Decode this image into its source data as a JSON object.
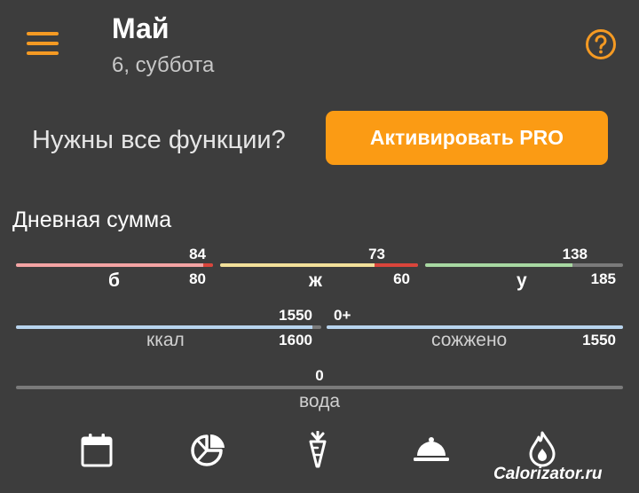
{
  "header": {
    "month": "Май",
    "date": "6, суббота"
  },
  "promo": {
    "text": "Нужны все функции?",
    "button_label": "Активировать PRO"
  },
  "summary": {
    "title": "Дневная сумма",
    "macros": [
      {
        "key": "protein",
        "label": "б",
        "value": "84",
        "goal": "80",
        "fraction": 1.0,
        "over_fraction": 0.05,
        "color": "#f4a4a4",
        "over_color": "#d9453b"
      },
      {
        "key": "fat",
        "label": "ж",
        "value": "73",
        "goal": "60",
        "fraction": 1.0,
        "over_fraction": 0.22,
        "color": "#f2e09a",
        "over_color": "#d9453b"
      },
      {
        "key": "carbs",
        "label": "у",
        "value": "138",
        "goal": "185",
        "fraction": 0.746,
        "over_fraction": 0,
        "color": "#a8d8a2",
        "over_color": ""
      }
    ],
    "calories": {
      "label": "ккал",
      "value": "1550",
      "goal": "1600",
      "fraction": 0.97,
      "color": "#b8d4ee"
    },
    "burned": {
      "label": "сожжено",
      "value": "0+",
      "goal": "1550",
      "fraction": 1.0,
      "color": "#b8d4ee"
    },
    "water": {
      "label": "вода",
      "value": "0",
      "fraction": 0
    }
  },
  "nav": [
    {
      "name": "calendar-icon"
    },
    {
      "name": "pie-chart-icon"
    },
    {
      "name": "carrot-icon"
    },
    {
      "name": "meal-cloche-icon"
    },
    {
      "name": "flame-drop-icon"
    }
  ],
  "watermark": "Calorizator.ru",
  "colors": {
    "accent": "#f59a23",
    "background": "#3d3d3d",
    "button": "#fb9b14"
  }
}
